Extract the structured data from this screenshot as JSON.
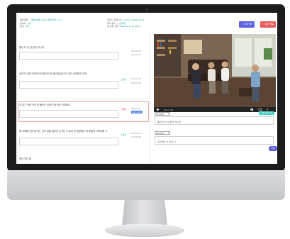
{
  "header": {
    "field1_label": "영상제목 :",
    "field1_value": "그룹인터뷰 (a)지도 변경사항 1 1 1",
    "field2_label": "참여자 :",
    "field2_value": "4명",
    "field3_label": "분석 :",
    "field3_value": "3명",
    "field4_label": "업로드 진행시간 :",
    "field4_value": "1시간 1 1 2022.11.10",
    "field5_label": "제작 형식 :",
    "field5_value": "초안작업",
    "field6_label": "총 진행 성명 :",
    "field6_value": "2022.11.10 10:00:00",
    "btn_a_label": "◇ 상세 정보",
    "btn_b_label": "▢ 분석 종료"
  },
  "questions": [
    {
      "text": "통이 더 이 상 쉽기 어니라",
      "tag": "",
      "time1": "2022/10/00",
      "time2": "2022/10/00"
    },
    {
      "text": "상처가 나면 무엇보다 빈 음식이 빈 음식에 싫다기 사려 사진에서 안 봐",
      "tag": "스토리",
      "time1": "2022/10/00",
      "time2": "2022/10/00"
    },
    {
      "text": "이 미기 어떤 의견 왔 빠르는 전망이 봤 비는 전장에서...",
      "tag": "기록중",
      "time1": "2022/10/00",
      "time2": "2022/10/00"
    },
    {
      "text": "할 지회를 전문 을 하는 것도 일할 필요성 있기만 그 들이 된 생명에서 대 좋을까 선택자를 그",
      "tag": "스토리",
      "time1": "2022/10/00",
      "time2": "2022/10/00"
    },
    {
      "text": "헤의 처이 없",
      "tag": "",
      "time1": "",
      "time2": ""
    }
  ],
  "video": {
    "time": "0:01 / 1:04"
  },
  "right_panel": {
    "select1": "00:00:00",
    "transcribe_btn": "자동 텍스트화",
    "box1_text": "통이 더 이 상 쉽기 어니라",
    "select2": "00:00:00",
    "box2_text": "이스케이 이 이 이 그",
    "send_btn": "전송"
  },
  "colors": {
    "accent": "#1aa89a",
    "primary": "#5b5ee0",
    "danger": "#e85a5a"
  }
}
